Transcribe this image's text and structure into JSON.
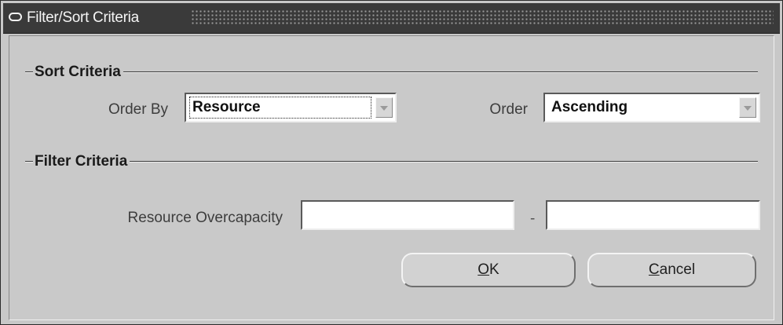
{
  "window": {
    "title": "Filter/Sort Criteria",
    "title_icon": "window-menu-icon"
  },
  "sort_section": {
    "title": "Sort Criteria",
    "order_by_label": "Order By",
    "order_by_value": "Resource",
    "order_label": "Order",
    "order_value": "Ascending"
  },
  "filter_section": {
    "title": "Filter Criteria",
    "resource_overcapacity_label": "Resource Overcapacity",
    "range_separator": "-",
    "from_value": "",
    "to_value": ""
  },
  "buttons": {
    "ok": {
      "mnemonic": "O",
      "rest": "K"
    },
    "cancel": {
      "mnemonic": "C",
      "rest": "ancel"
    }
  },
  "icons": {
    "dropdown": "chevron-down-icon"
  },
  "colors": {
    "titlebar": "#3a3a3a",
    "dialog_background": "#c9c9c9",
    "field_background": "#ffffff"
  }
}
